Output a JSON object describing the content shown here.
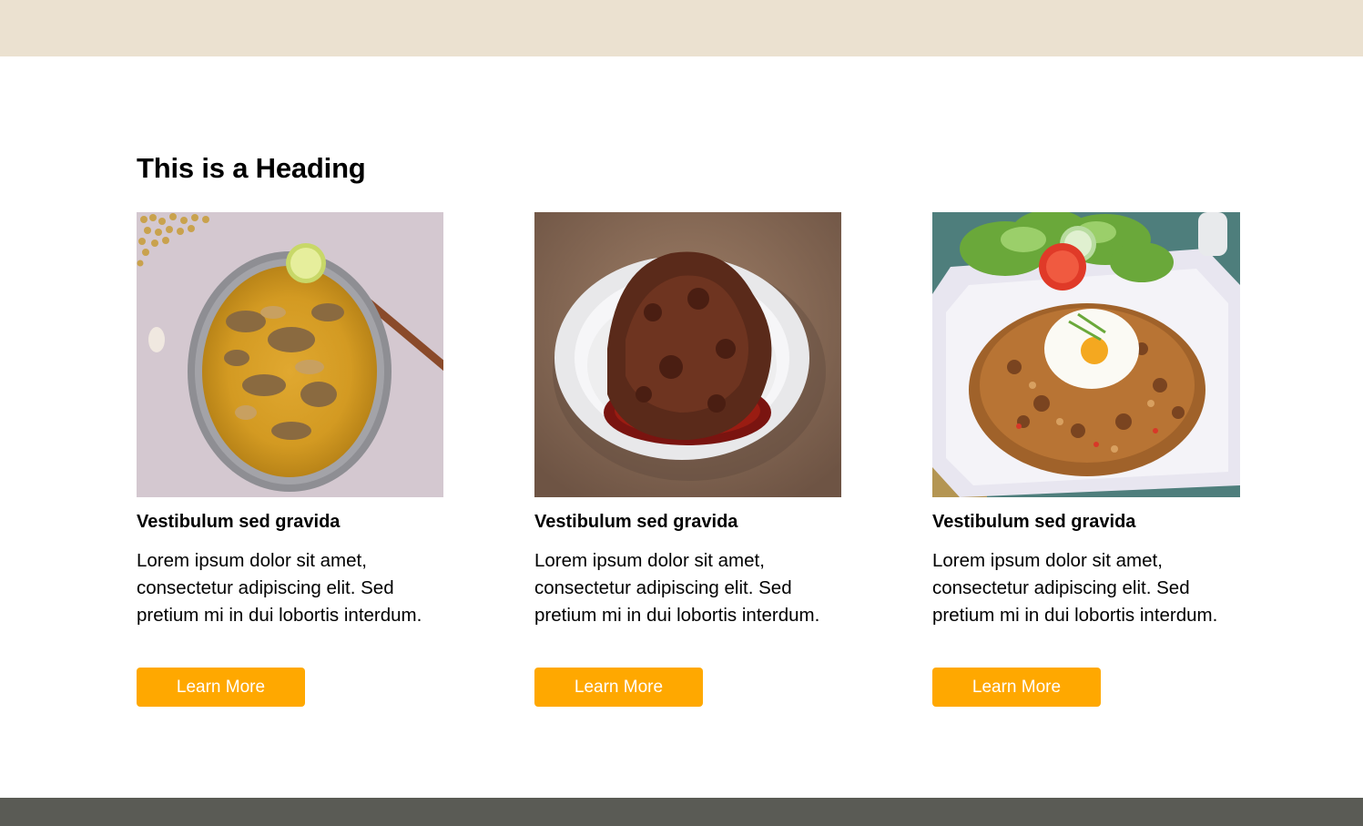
{
  "colors": {
    "top_bar": "#ebe1d0",
    "footer_bar": "#5a5b55",
    "button_bg": "#ffa800",
    "button_text": "#ffffff"
  },
  "section": {
    "heading": "This is a Heading"
  },
  "cards": [
    {
      "image_icon": "soup-bowl-image",
      "title": "Vestibulum sed gravida",
      "text": "Lorem ipsum dolor sit amet, consectetur adipiscing elit. Sed pretium mi in dui lobortis interdum.",
      "button_label": "Learn More"
    },
    {
      "image_icon": "beef-rendang-image",
      "title": "Vestibulum sed gravida",
      "text": "Lorem ipsum dolor sit amet, consectetur adipiscing elit. Sed pretium mi in dui lobortis interdum.",
      "button_label": "Learn More"
    },
    {
      "image_icon": "fried-rice-image",
      "title": "Vestibulum sed gravida",
      "text": "Lorem ipsum dolor sit amet, consectetur adipiscing elit. Sed pretium mi in dui lobortis interdum.",
      "button_label": "Learn More"
    }
  ]
}
